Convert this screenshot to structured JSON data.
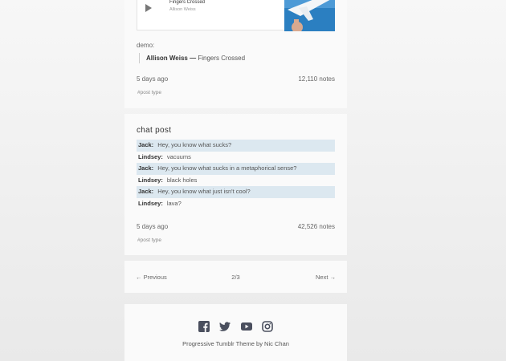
{
  "audio_post": {
    "track_title": "Fingers Crossed",
    "track_artist": "Allison Weiss",
    "demo_label": "demo:",
    "quote_artist": "Allison Weiss",
    "quote_sep": " — ",
    "quote_title": "Fingers Crossed",
    "date": "5 days ago",
    "notes": "12,110 notes",
    "tag": "#post type"
  },
  "chat_post": {
    "title": "chat post",
    "lines": [
      {
        "speaker": "Jack:",
        "text": "Hey, you know what sucks?"
      },
      {
        "speaker": "Lindsey:",
        "text": "vacuums"
      },
      {
        "speaker": "Jack:",
        "text": "Hey, you know what sucks in a metaphorical sense?"
      },
      {
        "speaker": "Lindsey:",
        "text": "black holes"
      },
      {
        "speaker": "Jack:",
        "text": "Hey, you know what just isn't cool?"
      },
      {
        "speaker": "Lindsey:",
        "text": "lava?"
      }
    ],
    "date": "5 days ago",
    "notes": "42,526 notes",
    "tag": "#post type"
  },
  "pagination": {
    "previous": "← Previous",
    "page": "2/3",
    "next": "Next →"
  },
  "footer": {
    "icons": [
      "facebook-icon",
      "twitter-icon",
      "youtube-icon",
      "instagram-icon"
    ],
    "icon_color": "#4a4f5e",
    "credit": "Progressive Tumblr Theme by Nic Chan"
  },
  "colors": {
    "chat_highlight": "#dce8f0",
    "card_background": "#fafafa"
  }
}
